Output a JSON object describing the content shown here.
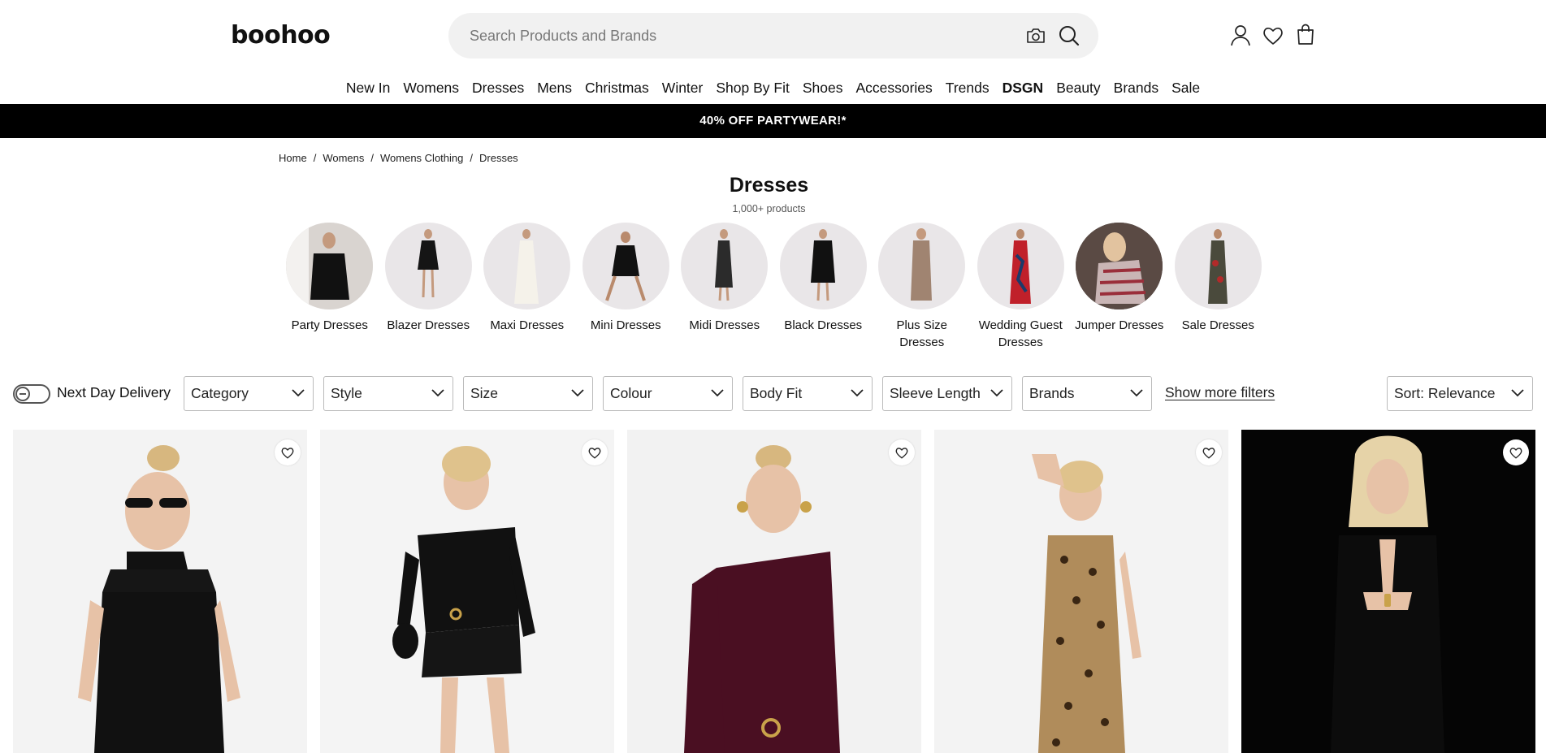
{
  "header": {
    "logo": "boohoo",
    "search_placeholder": "Search Products and Brands",
    "icons": [
      "camera-icon",
      "search-icon",
      "account-icon",
      "wishlist-icon",
      "bag-icon"
    ]
  },
  "nav": {
    "items": [
      "New In",
      "Womens",
      "Dresses",
      "Mens",
      "Christmas",
      "Winter",
      "Shop By Fit",
      "Shoes",
      "Accessories",
      "Trends",
      "DSGN",
      "Beauty",
      "Brands",
      "Sale"
    ]
  },
  "promo": {
    "text": "40% OFF PARTYWEAR!*"
  },
  "breadcrumb": [
    "Home",
    "Womens",
    "Womens Clothing",
    "Dresses"
  ],
  "page": {
    "title": "Dresses",
    "count": "1,000+ products"
  },
  "categories": [
    "Party Dresses",
    "Blazer Dresses",
    "Maxi Dresses",
    "Mini Dresses",
    "Midi Dresses",
    "Black Dresses",
    "Plus Size Dresses",
    "Wedding Guest Dresses",
    "Jumper Dresses",
    "Sale Dresses"
  ],
  "filters": {
    "next_day_delivery": "Next Day Delivery",
    "next_day_on": false,
    "selects": [
      "Category",
      "Style",
      "Size",
      "Colour",
      "Body Fit",
      "Sleeve Length",
      "Brands"
    ],
    "show_more": "Show more filters",
    "sort": "Sort: Relevance"
  },
  "colors": {
    "promo_bg": "#000000",
    "search_bg": "#f1f1f1",
    "text": "#111111"
  }
}
